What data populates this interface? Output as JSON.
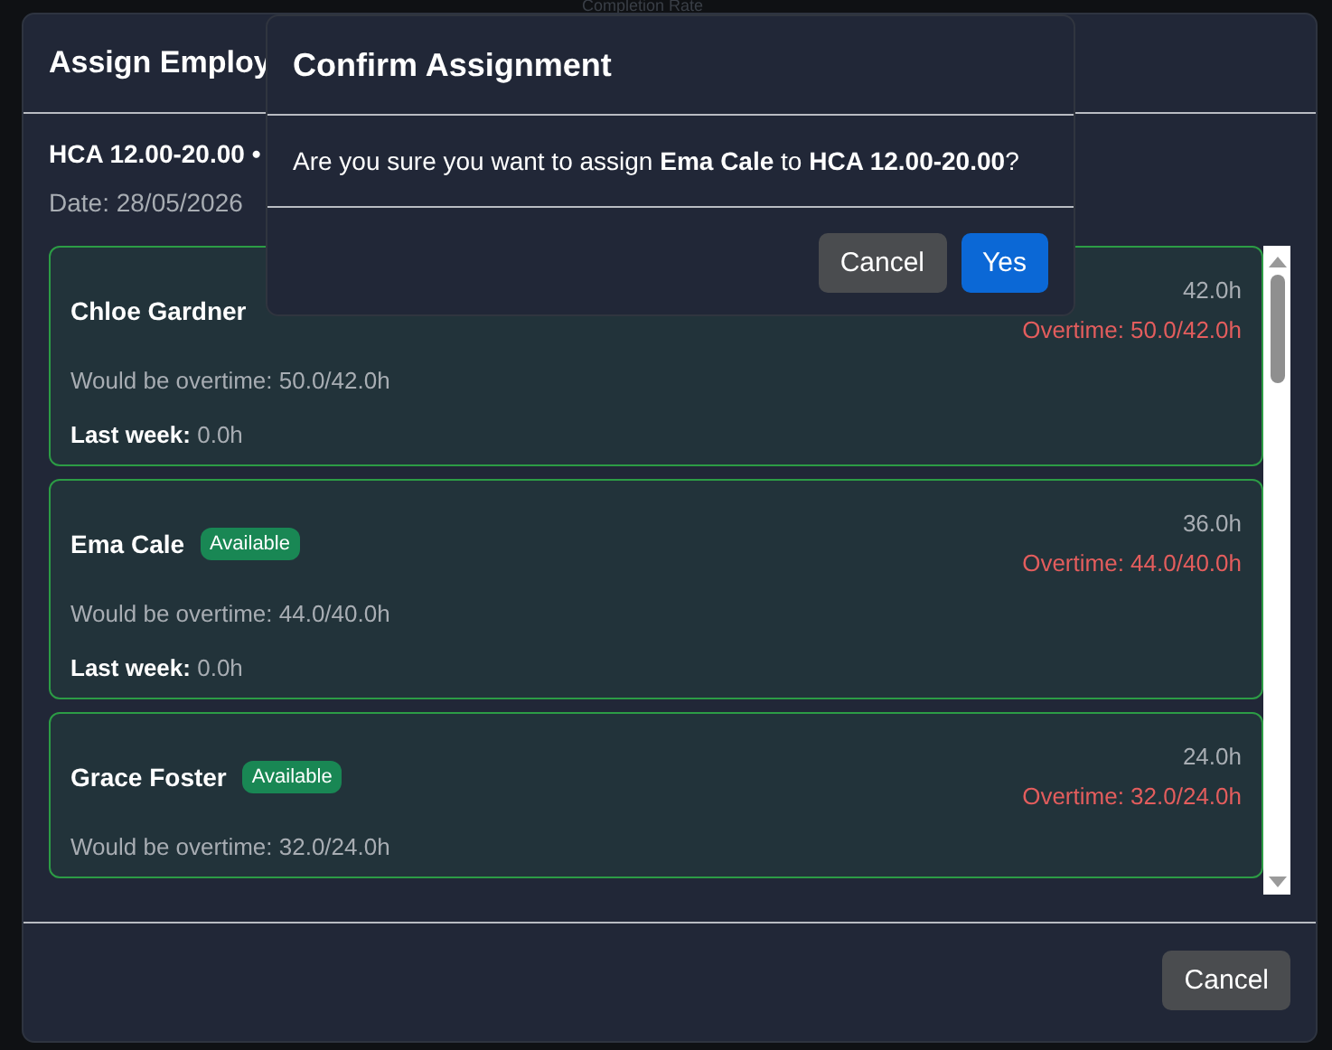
{
  "background": {
    "heading": "Completion Rate"
  },
  "assign_modal": {
    "title": "Assign Employ",
    "shift": "HCA 12.00-20.00 •",
    "date": "Date: 28/05/2026",
    "employees": [
      {
        "name": "Chloe Gardner",
        "hours": "42.0h",
        "overtime": "Overtime: 50.0/42.0h",
        "would_be": "Would be overtime: 50.0/42.0h",
        "last_week_label": "Last week:",
        "last_week_value": "0.0h"
      },
      {
        "name": "Ema Cale",
        "badge": "Available",
        "hours": "36.0h",
        "overtime": "Overtime: 44.0/40.0h",
        "would_be": "Would be overtime: 44.0/40.0h",
        "last_week_label": "Last week:",
        "last_week_value": "0.0h"
      },
      {
        "name": "Grace Foster",
        "badge": "Available",
        "hours": "24.0h",
        "overtime": "Overtime: 32.0/24.0h",
        "would_be": "Would be overtime: 32.0/24.0h"
      }
    ],
    "cancel_button": "Cancel"
  },
  "confirm_dialog": {
    "title": "Confirm Assignment",
    "message": "Are you sure you want to assign **Ema Cale** to **HCA 12.00-20.00**?",
    "buttons": [
      {
        "label": "Cancel",
        "kind": "secondary"
      },
      {
        "label": "Yes",
        "kind": "primary"
      }
    ]
  }
}
